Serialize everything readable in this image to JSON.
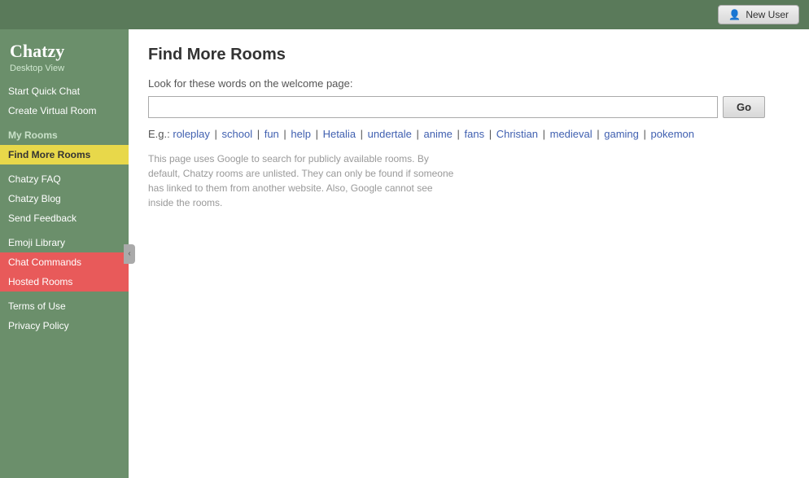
{
  "topbar": {
    "new_user_label": "New User"
  },
  "sidebar": {
    "logo": "Chatzy",
    "desktop_view": "Desktop View",
    "items": [
      {
        "id": "start-quick-chat",
        "label": "Start Quick Chat",
        "state": "normal"
      },
      {
        "id": "create-virtual-room",
        "label": "Create Virtual Room",
        "state": "normal"
      },
      {
        "id": "my-rooms",
        "label": "My Rooms",
        "state": "section-header"
      },
      {
        "id": "find-more-rooms",
        "label": "Find More Rooms",
        "state": "active-yellow"
      },
      {
        "id": "chatzy-faq",
        "label": "Chatzy FAQ",
        "state": "normal"
      },
      {
        "id": "chatzy-blog",
        "label": "Chatzy Blog",
        "state": "normal"
      },
      {
        "id": "send-feedback",
        "label": "Send Feedback",
        "state": "normal"
      },
      {
        "id": "emoji-library",
        "label": "Emoji Library",
        "state": "normal"
      },
      {
        "id": "chat-commands",
        "label": "Chat Commands",
        "state": "highlighted"
      },
      {
        "id": "hosted-rooms",
        "label": "Hosted Rooms",
        "state": "highlighted"
      },
      {
        "id": "terms-of-use",
        "label": "Terms of Use",
        "state": "normal"
      },
      {
        "id": "privacy-policy",
        "label": "Privacy Policy",
        "state": "normal"
      }
    ]
  },
  "main": {
    "title": "Find More Rooms",
    "search_label": "Look for these words on the welcome page:",
    "search_placeholder": "",
    "go_button": "Go",
    "examples_prefix": "E.g.:",
    "examples": [
      "roleplay",
      "school",
      "fun",
      "help",
      "Hetalia",
      "undertale",
      "anime",
      "fans",
      "Christian",
      "medieval",
      "gaming",
      "pokemon"
    ],
    "info_text": "This page uses Google to search for publicly available rooms. By default, Chatzy rooms are unlisted. They can only be found if someone has linked to them from another website. Also, Google cannot see inside the rooms."
  }
}
